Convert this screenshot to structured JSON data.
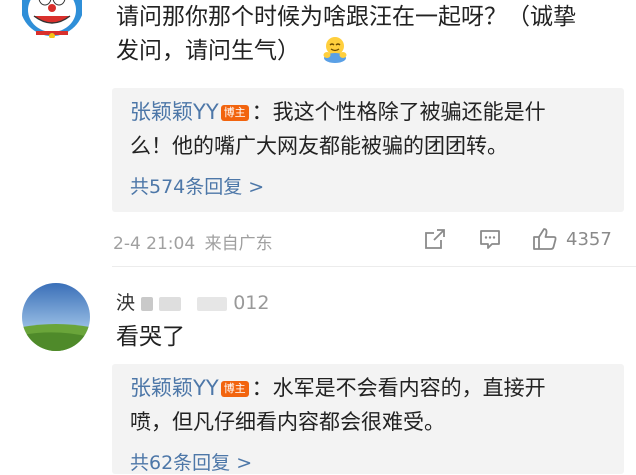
{
  "comment1": {
    "text_line1": "请问那你那个时候为啥跟汪在一起呀？（诚挚",
    "text_line2": "发问，请问生气）",
    "reply": {
      "author": "张颖颖YY",
      "badge": "博主",
      "text_line1": "：我这个性格除了被骗还能是什",
      "text_line2": "么！他的嘴广大网友都能被骗的团团转。",
      "more_replies": "共574条回复 >"
    },
    "timestamp": "2-4 21:04",
    "location": "来自广东",
    "like_count": "4357"
  },
  "comment2": {
    "username_visible": "泱",
    "username_suffix": "012",
    "text": "看哭了",
    "reply": {
      "author": "张颖颖YY",
      "badge": "博主",
      "text_line1": "：水军是不会看内容的，直接开",
      "text_line2": "喷，但凡仔细看内容都会很难受。",
      "more_replies": "共62条回复 >"
    }
  },
  "icons": [
    "doraemon-avatar-icon",
    "hug-emoji-icon",
    "share-icon",
    "comment-icon",
    "like-icon",
    "landscape-avatar-icon"
  ],
  "colors": {
    "link": "#4d77a8",
    "badge": "#f2640e",
    "meta": "#a0a0a0",
    "reply_bg": "#f3f3f3"
  }
}
